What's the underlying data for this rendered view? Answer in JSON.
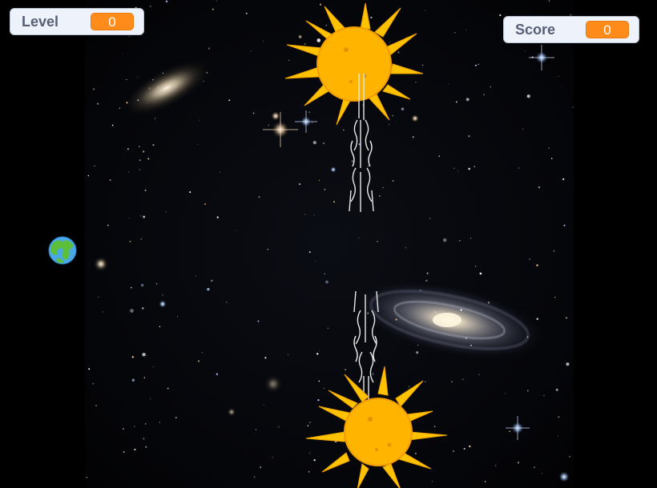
{
  "game": {
    "monitors": {
      "level": {
        "label": "Level",
        "value": "0"
      },
      "score": {
        "label": "Score",
        "value": "0"
      }
    }
  },
  "colors": {
    "backdrop_edge": "#000000",
    "monitor_bg": "#eef3fb",
    "monitor_value_bg": "#ff8c1a",
    "sun_body": "#ffb400",
    "sun_ray": "#ffc400"
  },
  "sprites": [
    "earth-player",
    "sun-obstacle-top",
    "sun-obstacle-bottom",
    "laser-beam-top",
    "laser-beam-bottom"
  ]
}
